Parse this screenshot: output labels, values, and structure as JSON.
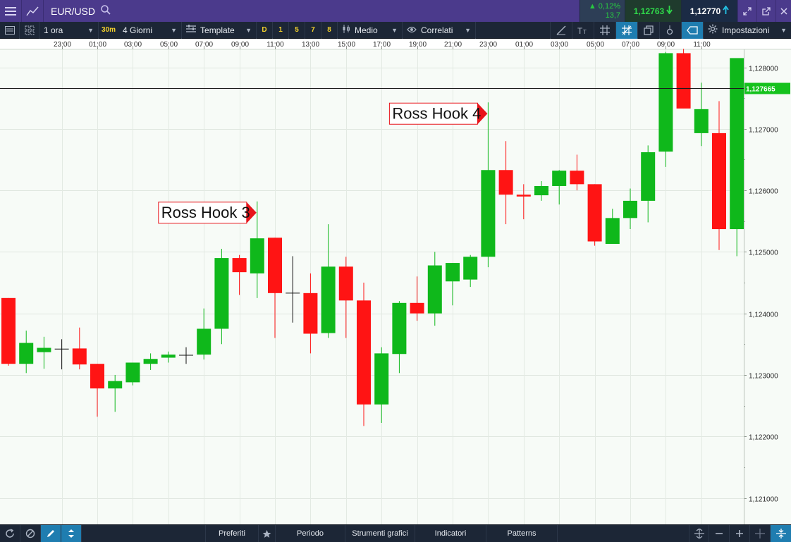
{
  "titlebar": {
    "symbol": "EUR/USD",
    "change_pct": "▲ 0,12%",
    "change_pts": "13,7",
    "sell_price": "1,12763",
    "buy_price": "1,12770",
    "colors": {
      "bar": "#4b3a8c",
      "up": "#2fd84a",
      "buy_arrow": "#22c3e6"
    }
  },
  "toolbar": {
    "interval": "1 ora",
    "interval_tag": "30m",
    "period": "4 Giorni",
    "template": "Template",
    "timeframes": [
      "D",
      "1",
      "5",
      "7",
      "8"
    ],
    "average": "Medio",
    "correlated": "Correlati",
    "settings": "Impostazioni"
  },
  "bottombar": {
    "favorites": "Preferiti",
    "period": "Periodo",
    "drawing_tools": "Strumenti grafici",
    "indicators": "Indicatori",
    "patterns": "Patterns"
  },
  "chart_data": {
    "type": "candlestick",
    "instrument": "EUR/USD",
    "interval": "1 ora",
    "x_tick_labels": [
      "23:00",
      "01:00",
      "03:00",
      "05:00",
      "07:00",
      "09:00",
      "11:00",
      "13:00",
      "15:00",
      "17:00",
      "19:00",
      "21:00",
      "23:00",
      "01:00",
      "03:00",
      "05:00",
      "07:00",
      "09:00",
      "11:00"
    ],
    "y_tick_labels": [
      "1,128000",
      "1,127000",
      "1,126000",
      "1,125000",
      "1,124000",
      "1,123000",
      "1,122000",
      "1,121000"
    ],
    "ylim": [
      1.1205,
      1.1284
    ],
    "current_price_label": "1,127665",
    "current_price": 1.127665,
    "candles": [
      {
        "o": 1.12425,
        "h": 1.12425,
        "l": 1.12315,
        "c": 1.12318
      },
      {
        "o": 1.12318,
        "h": 1.12372,
        "l": 1.12303,
        "c": 1.12352
      },
      {
        "o": 1.12337,
        "h": 1.12362,
        "l": 1.1231,
        "c": 1.12344
      },
      {
        "o": 1.12342,
        "h": 1.12358,
        "l": 1.12309,
        "c": 1.12342
      },
      {
        "o": 1.12343,
        "h": 1.12377,
        "l": 1.12309,
        "c": 1.12317
      },
      {
        "o": 1.12318,
        "h": 1.12318,
        "l": 1.12232,
        "c": 1.12278
      },
      {
        "o": 1.12278,
        "h": 1.123,
        "l": 1.1224,
        "c": 1.1229
      },
      {
        "o": 1.12288,
        "h": 1.1232,
        "l": 1.12283,
        "c": 1.1232
      },
      {
        "o": 1.12318,
        "h": 1.12335,
        "l": 1.12308,
        "c": 1.12326
      },
      {
        "o": 1.12328,
        "h": 1.12338,
        "l": 1.1232,
        "c": 1.12333
      },
      {
        "o": 1.12332,
        "h": 1.12345,
        "l": 1.12318,
        "c": 1.12332
      },
      {
        "o": 1.12333,
        "h": 1.12408,
        "l": 1.12325,
        "c": 1.12375
      },
      {
        "o": 1.12375,
        "h": 1.12505,
        "l": 1.1235,
        "c": 1.1249
      },
      {
        "o": 1.1249,
        "h": 1.12495,
        "l": 1.1243,
        "c": 1.12467
      },
      {
        "o": 1.12465,
        "h": 1.12582,
        "l": 1.12425,
        "c": 1.12522
      },
      {
        "o": 1.12523,
        "h": 1.12523,
        "l": 1.1236,
        "c": 1.12433
      },
      {
        "o": 1.12433,
        "h": 1.12493,
        "l": 1.12385,
        "c": 1.12433
      },
      {
        "o": 1.12433,
        "h": 1.12465,
        "l": 1.12335,
        "c": 1.12367
      },
      {
        "o": 1.12368,
        "h": 1.12545,
        "l": 1.1236,
        "c": 1.12476
      },
      {
        "o": 1.12476,
        "h": 1.12492,
        "l": 1.1236,
        "c": 1.12421
      },
      {
        "o": 1.12421,
        "h": 1.1245,
        "l": 1.12217,
        "c": 1.12252
      },
      {
        "o": 1.12252,
        "h": 1.12345,
        "l": 1.12222,
        "c": 1.12335
      },
      {
        "o": 1.12334,
        "h": 1.1242,
        "l": 1.12303,
        "c": 1.12417
      },
      {
        "o": 1.12417,
        "h": 1.1246,
        "l": 1.12388,
        "c": 1.124
      },
      {
        "o": 1.124,
        "h": 1.125,
        "l": 1.1238,
        "c": 1.12478
      },
      {
        "o": 1.12452,
        "h": 1.12482,
        "l": 1.12413,
        "c": 1.12482
      },
      {
        "o": 1.12455,
        "h": 1.12495,
        "l": 1.12443,
        "c": 1.12492
      },
      {
        "o": 1.12492,
        "h": 1.12743,
        "l": 1.12475,
        "c": 1.12633
      },
      {
        "o": 1.12633,
        "h": 1.1268,
        "l": 1.12545,
        "c": 1.12593
      },
      {
        "o": 1.12593,
        "h": 1.1261,
        "l": 1.12553,
        "c": 1.1259
      },
      {
        "o": 1.12592,
        "h": 1.12615,
        "l": 1.12583,
        "c": 1.12607
      },
      {
        "o": 1.12607,
        "h": 1.12633,
        "l": 1.12577,
        "c": 1.12632
      },
      {
        "o": 1.12632,
        "h": 1.12658,
        "l": 1.126,
        "c": 1.1261
      },
      {
        "o": 1.1261,
        "h": 1.1261,
        "l": 1.1251,
        "c": 1.12517
      },
      {
        "o": 1.12513,
        "h": 1.1257,
        "l": 1.12513,
        "c": 1.12555
      },
      {
        "o": 1.12555,
        "h": 1.12603,
        "l": 1.12537,
        "c": 1.12583
      },
      {
        "o": 1.12583,
        "h": 1.12673,
        "l": 1.12548,
        "c": 1.12662
      },
      {
        "o": 1.12663,
        "h": 1.12825,
        "l": 1.12638,
        "c": 1.12823
      },
      {
        "o": 1.12823,
        "h": 1.1283,
        "l": 1.12733,
        "c": 1.12733
      },
      {
        "o": 1.12693,
        "h": 1.12775,
        "l": 1.12672,
        "c": 1.12732
      },
      {
        "o": 1.12693,
        "h": 1.12745,
        "l": 1.12503,
        "c": 1.12537
      },
      {
        "o": 1.12537,
        "h": 1.1281,
        "l": 1.12493,
        "c": 1.12815
      }
    ],
    "annotations": [
      {
        "text": "Ross Hook 3",
        "candle_index": 14,
        "price": 1.12582
      },
      {
        "text": "Ross Hook 4",
        "candle_index": 27,
        "price": 1.12743
      }
    ],
    "grid": true,
    "colors": {
      "up": "#0fb81b",
      "down": "#ff1414",
      "background": "#f7fbf7",
      "annotation": "#e8141b",
      "price_tag": "#15c21d"
    }
  }
}
